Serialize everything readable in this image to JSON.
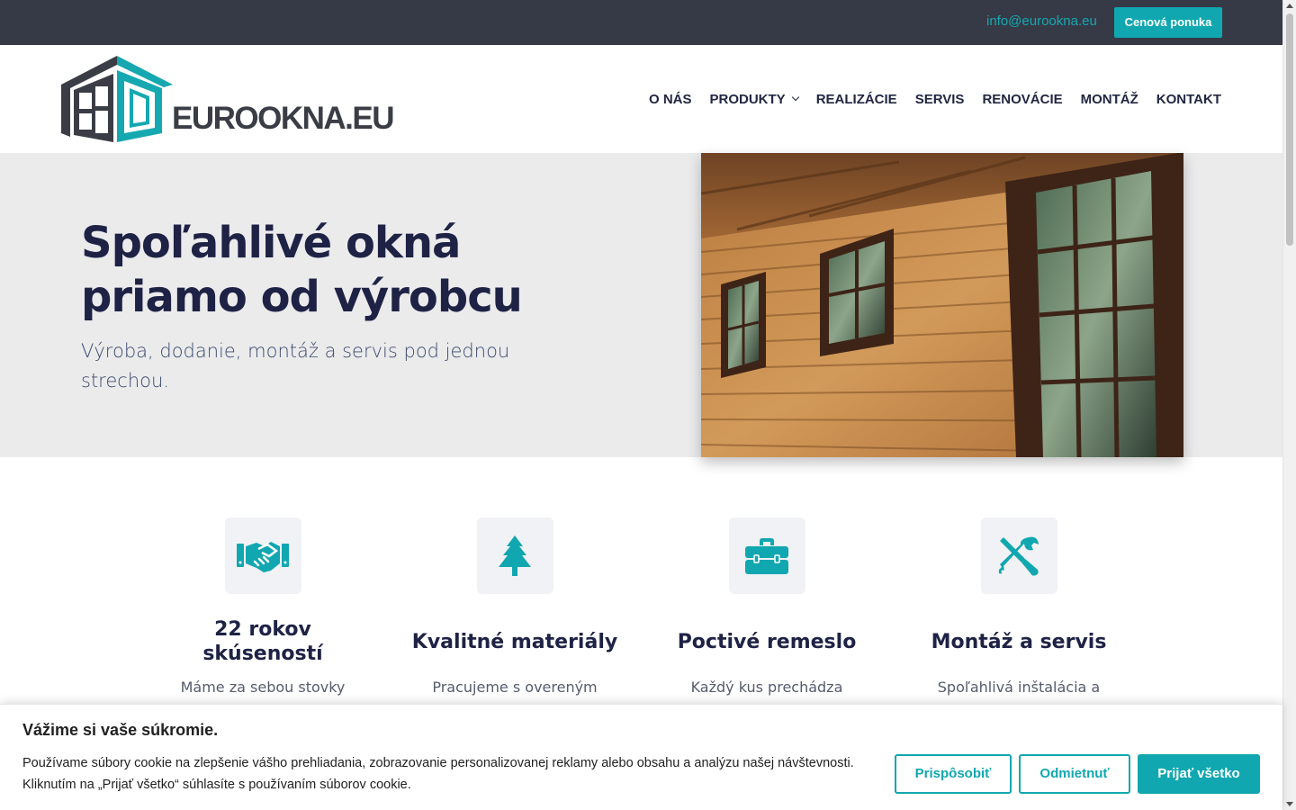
{
  "topbar": {
    "email": "info@eurookna.eu",
    "quote_button": "Cenová ponuka"
  },
  "logo": {
    "text": "EUROOKNA.EU"
  },
  "nav": {
    "items": [
      {
        "label": "O NÁS"
      },
      {
        "label": "PRODUKTY",
        "has_dropdown": true
      },
      {
        "label": "REALIZÁCIE"
      },
      {
        "label": "SERVIS"
      },
      {
        "label": "RENOVÁCIE"
      },
      {
        "label": "MONTÁŽ"
      },
      {
        "label": "KONTAKT"
      }
    ]
  },
  "hero": {
    "title": "Spoľahlivé okná priamo od výrobcu",
    "subtitle": "Výroba, dodanie, montáž a servis pod jednou strechou."
  },
  "features": [
    {
      "icon": "handshake-icon",
      "title": "22 rokov skúseností",
      "text": "Máme za sebou stovky"
    },
    {
      "icon": "tree-icon",
      "title": "Kvalitné materiály",
      "text": "Pracujeme s overeným"
    },
    {
      "icon": "toolbox-icon",
      "title": "Poctivé remeslo",
      "text": "Každý kus prechádza"
    },
    {
      "icon": "tools-icon",
      "title": "Montáž a servis",
      "text": "Spoľahlivá inštalácia a"
    }
  ],
  "cookie": {
    "title": "Vážime si vaše súkromie.",
    "text": "Používame súbory cookie na zlepšenie vášho prehliadania, zobrazovanie personalizovanej reklamy alebo obsahu a analýzu našej návštevnosti. Kliknutím na „Prijať všetko“ súhlasíte s používaním súborov cookie.",
    "customize_button": "Prispôsobiť",
    "reject_button": "Odmietnuť",
    "accept_button": "Prijať všetko"
  },
  "colors": {
    "accent": "#11a7b0",
    "topbar_bg": "#353a46",
    "hero_bg": "#ebebec",
    "heading": "#1e2245"
  }
}
